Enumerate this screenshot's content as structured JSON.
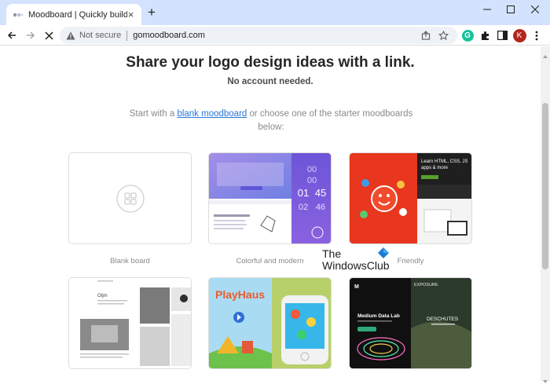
{
  "browser": {
    "tab_title": "Moodboard | Quickly build beautiful",
    "new_tab_symbol": "+",
    "tab_close_symbol": "×",
    "security_label": "Not secure",
    "url": "gomoodboard.com",
    "profile_initial": "K",
    "extension_badge": "G"
  },
  "page": {
    "headline": "Share your logo design ideas with a link.",
    "subline": "No account needed.",
    "intro_prefix": "Start with a ",
    "intro_link": "blank moodboard",
    "intro_suffix": " or choose one of the starter moodboards below:"
  },
  "boards": [
    {
      "label": "Blank board"
    },
    {
      "label": "Colorful and modern"
    },
    {
      "label": "Friendly"
    }
  ],
  "thumbnails": {
    "clock_digits": [
      "00",
      "01",
      "02",
      "45",
      "46",
      "0"
    ],
    "learn_title": "Learn HTML, CSS, JS apps & more",
    "medium_title": "Medium Data Lab",
    "playhaus_title": "PlayHaus",
    "descriptive_title": "DESCHUTES",
    "exposure_label": "EXPOSURE",
    "otjm_title": "Otjm"
  },
  "watermark": {
    "line1": "The",
    "line2": "WindowsClub"
  },
  "colors": {
    "chrome": "#d3e3fd",
    "link": "#2a78d6",
    "headline": "#262626",
    "muted": "#8a8a8a"
  }
}
